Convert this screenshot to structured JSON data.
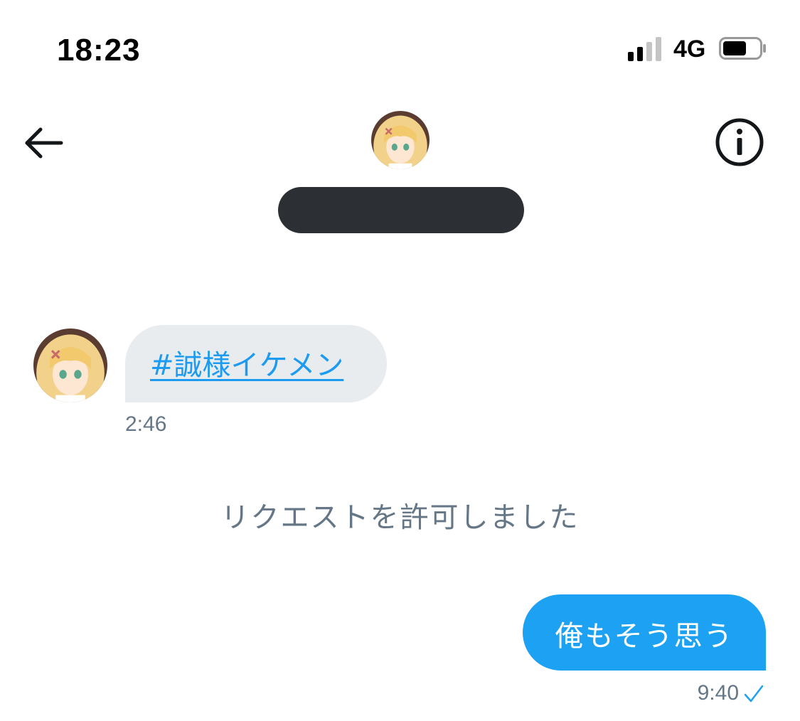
{
  "status_bar": {
    "time": "18:23",
    "network": "4G",
    "signal_bars_active": 2,
    "signal_bars_total": 4,
    "battery_level": 0.55
  },
  "header": {
    "back_icon": "arrow-left-icon",
    "info_icon": "info-circle-icon",
    "avatar_icon": "anime-avatar"
  },
  "conversation": {
    "incoming": {
      "text": "#誠様イケメン",
      "time": "2:46"
    },
    "system_text": "リクエストを許可しました",
    "outgoing": {
      "text": "俺もそう思う",
      "time": "9:40"
    }
  },
  "colors": {
    "link": "#1d9bf0",
    "outgoing_bubble": "#1da1f2",
    "incoming_bubble": "#e8ecef",
    "meta_text": "#657786"
  }
}
